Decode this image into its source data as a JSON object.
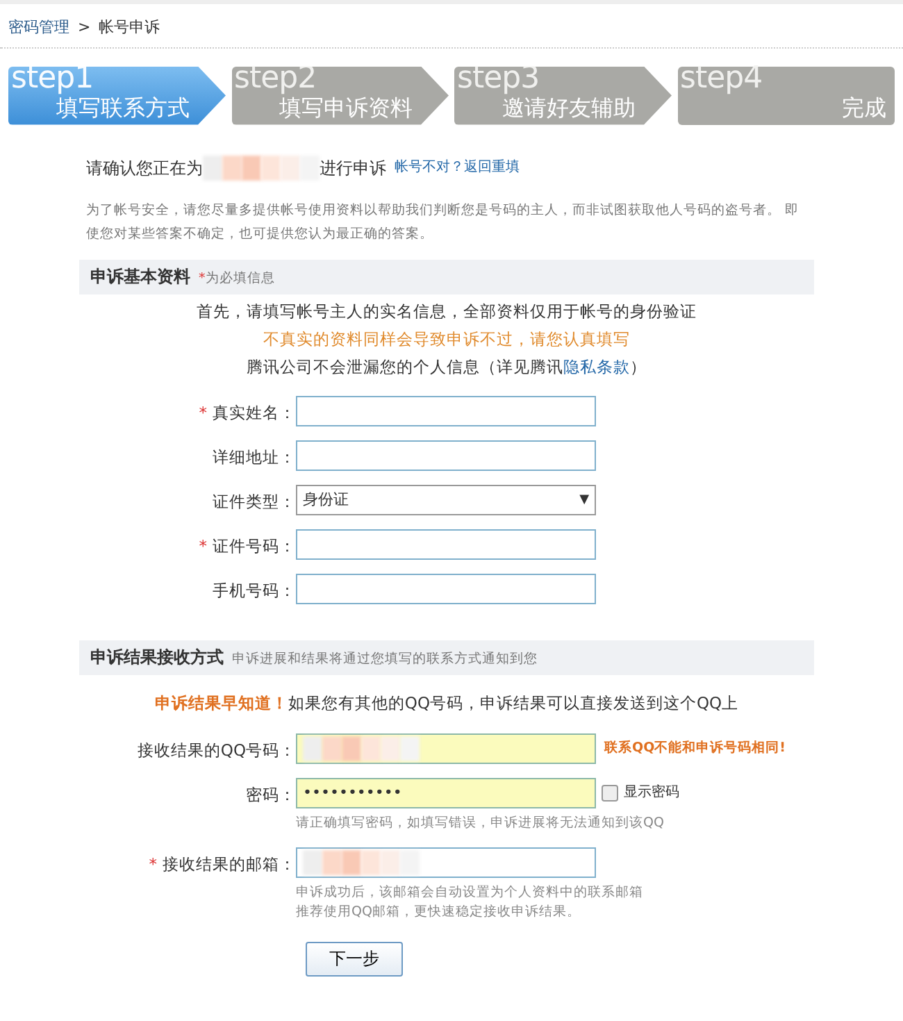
{
  "breadcrumb": {
    "items": [
      "密码管理",
      "帐号申诉"
    ],
    "separator": ">"
  },
  "steps": [
    {
      "number": "step1",
      "label": "填写联系方式",
      "selected": true
    },
    {
      "number": "step2",
      "label": "填写申诉资料",
      "selected": false
    },
    {
      "number": "step3",
      "label": "邀请好友辅助",
      "selected": false
    },
    {
      "number": "step4",
      "label": "完成",
      "selected": false
    }
  ],
  "account_line": {
    "before": "请确认您正在为",
    "account_redacted": true,
    "after": "进行申诉",
    "link": "帐号不对？返回重填"
  },
  "intro": "为了帐号安全，请您尽量多提供帐号使用资料以帮助我们判断您是号码的主人，而非试图获取他人号码的盗号者。 即使您对某些答案不确定，也可提供您认为最正确的答案。",
  "basic_section": {
    "title": "申诉基本资料",
    "note_mark": "*",
    "note": "为必填信息",
    "lines": [
      {
        "kind": "plain",
        "text": "首先，请填写帐号主人的实名信息，全部资料仅用于帐号的身份验证"
      },
      {
        "kind": "warning",
        "text": "不真实的资料同样会导致申诉不过，请您认真填写"
      },
      {
        "kind": "plain",
        "text": "腾讯公司不会泄漏您的个人信息（详见腾讯",
        "link": "隐私条款",
        "after": "）"
      }
    ],
    "fields": [
      {
        "kind": "text",
        "label": "真实姓名：",
        "required": true
      },
      {
        "kind": "text",
        "label": "详细地址：",
        "required": false
      },
      {
        "kind": "select",
        "label": "证件类型：",
        "required": false,
        "value": "身份证",
        "caret": "▼"
      },
      {
        "kind": "text",
        "label": "证件号码：",
        "required": true
      },
      {
        "kind": "text",
        "label": "手机号码：",
        "required": false
      }
    ]
  },
  "result_section": {
    "title": "申诉结果接收方式",
    "note": "申诉进展和结果将通过您填写的联系方式通知到您",
    "tip_highlight": "申诉结果早知道！",
    "tip": "如果您有其他的QQ号码，申诉结果可以直接发送到这个QQ上",
    "fields": [
      {
        "kind": "text",
        "label": "接收结果的QQ号码：",
        "required": false,
        "highlighted": true,
        "redacted": true,
        "error": "联系QQ不能和申诉号码相同!"
      },
      {
        "kind": "password",
        "label": "密码：",
        "required": false,
        "highlighted": true,
        "value": "•••••••••••",
        "checkbox": {
          "label": "显示密码",
          "checked": false
        },
        "hints": [
          "请正确填写密码，如填写错误，申诉进展将无法通知到该QQ"
        ]
      },
      {
        "kind": "text",
        "label": "接收结果的邮箱：",
        "required": true,
        "highlighted": false,
        "redacted": true,
        "hints": [
          "申诉成功后，该邮箱会自动设置为个人资料中的联系邮箱",
          "推荐使用QQ邮箱，更快速稳定接收申诉结果。"
        ]
      }
    ]
  },
  "next_button": "下一步"
}
